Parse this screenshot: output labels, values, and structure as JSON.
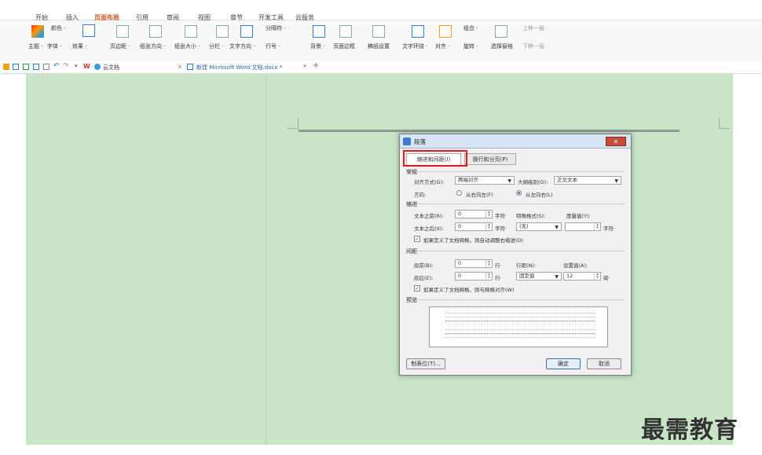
{
  "menubar": {
    "items": [
      "开始",
      "插入",
      "页面布局",
      "引用",
      "审阅",
      "视图",
      "章节",
      "开发工具",
      "云服务"
    ],
    "active": "页面布局"
  },
  "ribbon": {
    "row1": [
      "颜色 ·",
      "分隔符 ·",
      "组合 ·",
      "上移一层 ·"
    ],
    "row2": [
      "主题 ·",
      "字体 ·",
      "效果 ·",
      "页边距 ·",
      "纸张方向 ·",
      "纸张大小 ·",
      "分栏 ·",
      "文字方向 ·",
      "行号 ·",
      "背景 ·",
      "页面边框",
      "稿纸设置",
      "文字环绕 ·",
      "对齐 ·",
      "旋转 ·",
      "选择窗格",
      "下移一层 ·"
    ]
  },
  "tabs": {
    "cloud": "云文档",
    "doc": "新建 Microsoft Word 文档.docx *",
    "add": "+"
  },
  "dialog": {
    "title": "段落",
    "close": "✕",
    "tab1": "缩进和间距(I)",
    "tab2": "换行和分页(P)",
    "general": "常规",
    "align_label": "对齐方式(G):",
    "align_value": "两端对齐",
    "outline_label": "大纲级别(O):",
    "outline_value": "正文文本",
    "direction_label": "方向:",
    "rtl": "从右向左(F)",
    "ltr": "从左向右(L)",
    "indent": "缩进",
    "before_text_label": "文本之前(R):",
    "before_text_value": "0",
    "after_text_label": "文本之后(X):",
    "after_text_value": "0",
    "unit_char": "字符·",
    "special_label": "特殊格式(S):",
    "special_value": "(无)",
    "measure_label": "度量值(Y):",
    "grid_indent": "如果定义了文档网格，则自动调整右缩进(D)",
    "spacing": "间距",
    "before_label": "段前(B):",
    "before_value": "0",
    "after_label": "段后(E):",
    "after_value": "0",
    "unit_line": "行·",
    "line_label": "行距(N):",
    "line_value": "固定值",
    "setting_label": "设置值(A):",
    "setting_value": "12",
    "unit_pt": "磅·",
    "grid_align": "如果定义了文档网格，则与网格对齐(W)",
    "preview": "预览",
    "tabs_btn": "制表位(T)...",
    "ok": "确定",
    "cancel": "取消"
  },
  "watermark": "最需教育"
}
